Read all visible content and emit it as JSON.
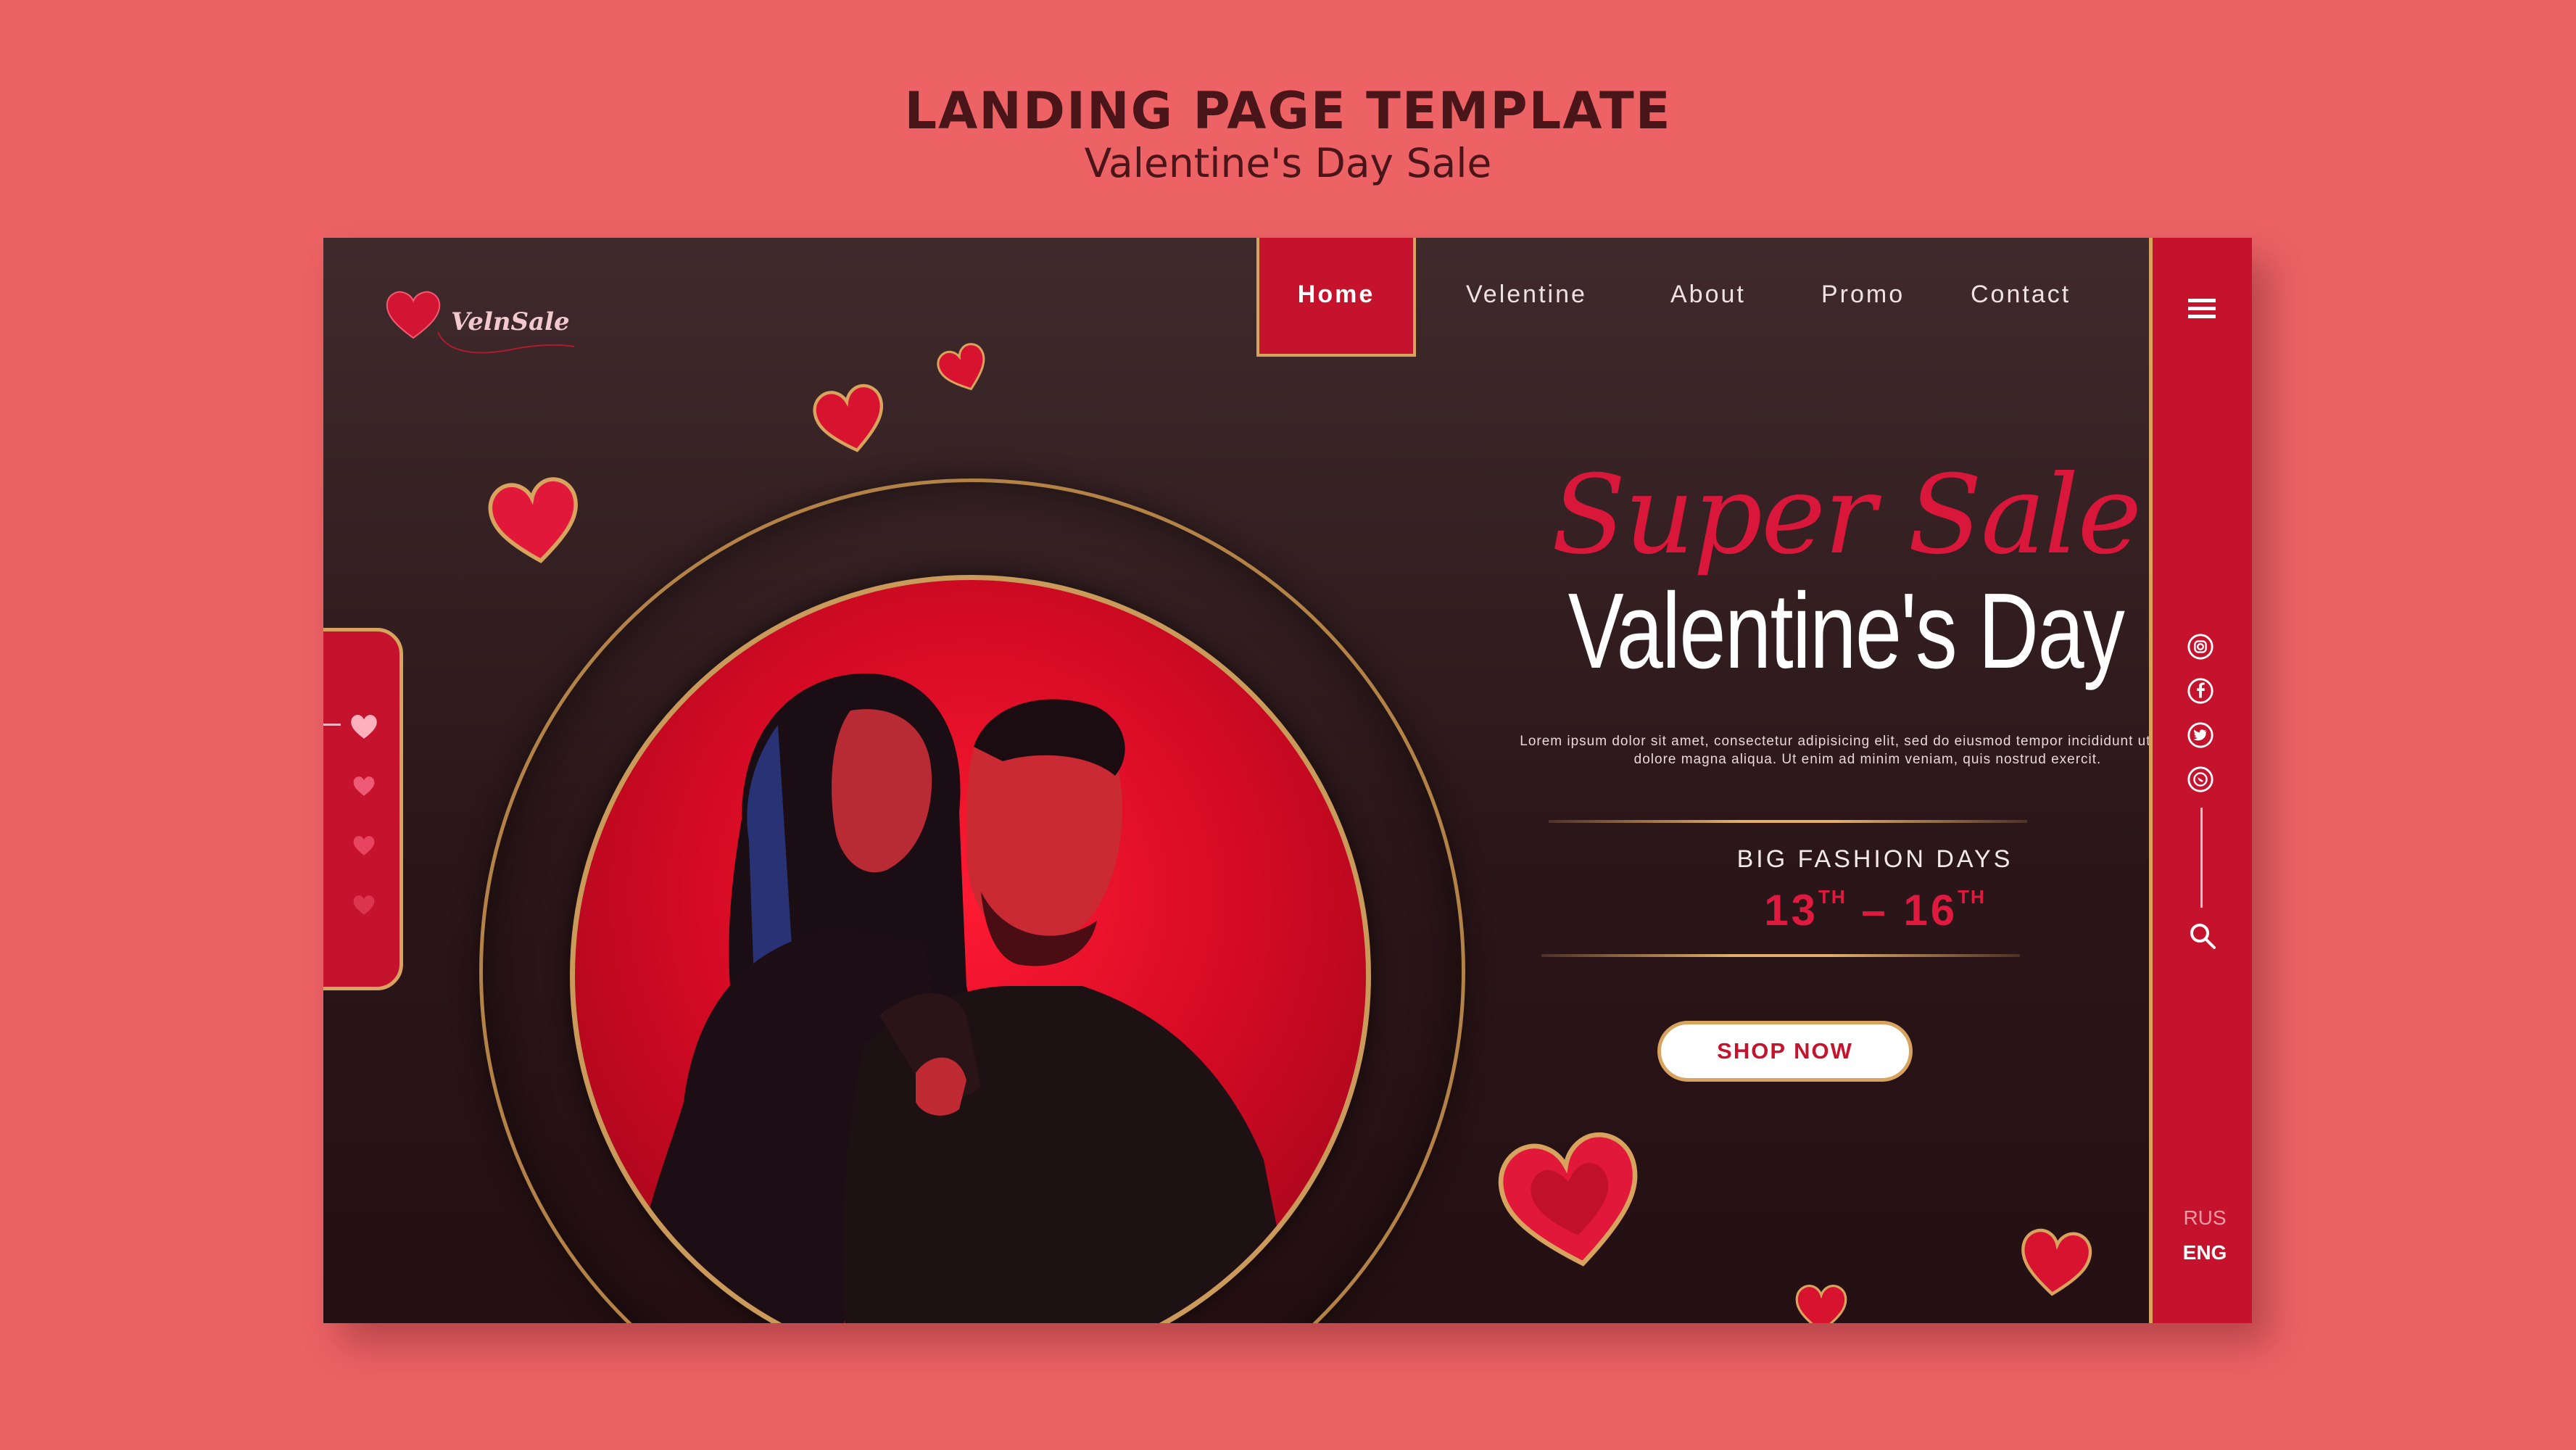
{
  "heading": {
    "title": "LANDING PAGE TEMPLATE",
    "subtitle": "Valentine's Day Sale"
  },
  "logo": {
    "text": "VelnSale"
  },
  "nav": {
    "items": [
      "Home",
      "Velentine",
      "About",
      "Promo",
      "Contact"
    ],
    "active": "Home"
  },
  "hero": {
    "script_title": "Super Sale",
    "title": "Valentine's Day",
    "description": "Lorem ipsum dolor sit amet, consectetur adipisicing elit, sed do eiusmod tempor incididunt ut labore et dolore magna aliqua. Ut enim ad minim veniam, quis nostrud exercit.",
    "event_label": "BIG FASHION DAYS",
    "date_start": "13",
    "date_start_suffix": "TH",
    "date_sep": " – ",
    "date_end": "16",
    "date_end_suffix": "TH",
    "cta": "SHOP NOW",
    "photo_alt": "couple-photo"
  },
  "sidebar": {
    "menu_icon": "hamburger-menu-icon",
    "social_icons": [
      "instagram-icon",
      "facebook-icon",
      "twitter-icon",
      "whatsapp-icon"
    ],
    "search_icon": "search-icon",
    "languages": [
      "RUS",
      "ENG"
    ],
    "active_language": "ENG"
  },
  "colors": {
    "page_bg": "#ec6265",
    "heading": "#4a1519",
    "brand_red": "#c5132d",
    "gold": "#d7a35e",
    "dark_bg": "#2b1619"
  }
}
